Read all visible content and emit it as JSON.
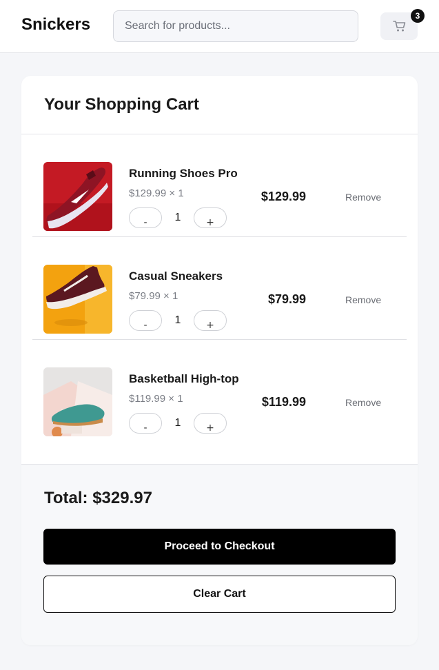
{
  "header": {
    "brand": "Snickers",
    "search_placeholder": "Search for products...",
    "cart_count": "3",
    "cart_icon": "shopping-cart-icon"
  },
  "cart": {
    "title": "Your Shopping Cart",
    "items": [
      {
        "name": "Running Shoes Pro",
        "unit_line": "$129.99 × 1",
        "quantity": "1",
        "line_total": "$129.99",
        "remove_label": "Remove",
        "minus_label": "-",
        "plus_label": "+",
        "image": "red-running-shoe-photo"
      },
      {
        "name": "Casual Sneakers",
        "unit_line": "$79.99 × 1",
        "quantity": "1",
        "line_total": "$79.99",
        "remove_label": "Remove",
        "minus_label": "-",
        "plus_label": "+",
        "image": "maroon-sneaker-on-yellow-photo"
      },
      {
        "name": "Basketball High-top",
        "unit_line": "$119.99 × 1",
        "quantity": "1",
        "line_total": "$119.99",
        "remove_label": "Remove",
        "minus_label": "-",
        "plus_label": "+",
        "image": "teal-shoe-on-pastel-photo"
      }
    ],
    "total": "Total: $329.97",
    "checkout_label": "Proceed to Checkout",
    "clear_label": "Clear Cart"
  },
  "colors": {
    "page_background": "#f5f6f9",
    "primary_button": "#000000",
    "text": "#1a1a1a",
    "muted_text": "#7a7d85"
  }
}
